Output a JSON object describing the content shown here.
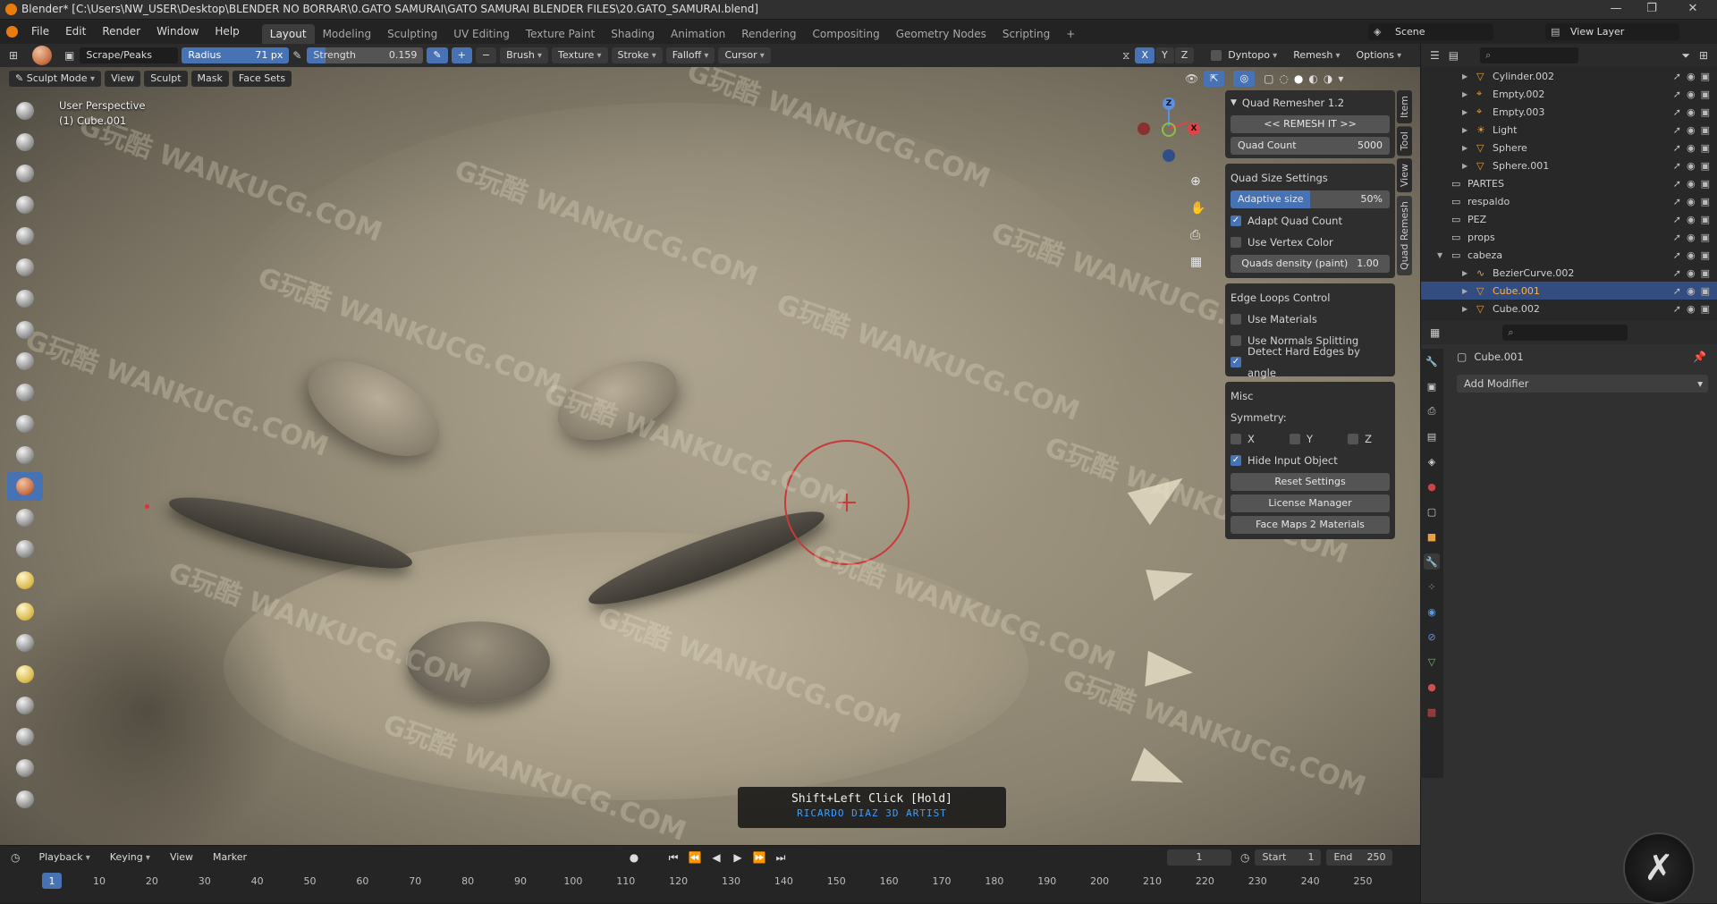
{
  "titlebar": {
    "title": "Blender* [C:\\Users\\NW_USER\\Desktop\\BLENDER NO BORRAR\\0.GATO SAMURAI\\GATO SAMURAI BLENDER FILES\\20.GATO_SAMURAI.blend]"
  },
  "menu": {
    "items": [
      "File",
      "Edit",
      "Render",
      "Window",
      "Help"
    ],
    "workspaces": [
      "Layout",
      "Modeling",
      "Sculpting",
      "UV Editing",
      "Texture Paint",
      "Shading",
      "Animation",
      "Rendering",
      "Compositing",
      "Geometry Nodes",
      "Scripting"
    ],
    "active_workspace": "Layout",
    "add_tab": "+",
    "scene": "Scene",
    "view_layer": "View Layer"
  },
  "tool_header": {
    "brush_name": "Scrape/Peaks",
    "radius_label": "Radius",
    "radius_value": "71 px",
    "strength_label": "Strength",
    "strength_value": "0.159",
    "plus": "+",
    "minus": "−",
    "brush": "Brush",
    "texture": "Texture",
    "stroke": "Stroke",
    "falloff": "Falloff",
    "cursor": "Cursor",
    "axis_x": "X",
    "axis_y": "Y",
    "axis_z": "Z",
    "dyntopo": "Dyntopo",
    "remesh": "Remesh",
    "options": "Options"
  },
  "viewport_header": {
    "mode": "Sculpt Mode",
    "view": "View",
    "sculpt": "Sculpt",
    "mask": "Mask",
    "face_sets": "Face Sets"
  },
  "viewport": {
    "perspective": "User Perspective",
    "object": "(1) Cube.001",
    "hint_key": "Shift+Left Click [Hold]",
    "hint_credit": "RICARDO DIAZ 3D ARTIST",
    "watermark": "G玩酷 WANKUCG.COM",
    "gizmo_x": "X",
    "gizmo_y": "Y",
    "gizmo_z": "Z"
  },
  "quad_remesher": {
    "title": "Quad Remesher 1.2",
    "remesh_btn": "<< REMESH IT >>",
    "quad_count_label": "Quad Count",
    "quad_count_value": "5000",
    "quad_size_settings": "Quad Size Settings",
    "adaptive_size_label": "Adaptive size",
    "adaptive_size_value": "50%",
    "adaptive_size_fraction": 0.5,
    "adapt_quad_count": "Adapt Quad Count",
    "use_vertex_color": "Use Vertex Color",
    "quads_density_label": "Quads density (paint)",
    "quads_density_value": "1.00",
    "edge_loops_control": "Edge Loops Control",
    "use_materials": "Use Materials",
    "use_normals_splitting": "Use Normals Splitting",
    "detect_hard_edges": "Detect Hard Edges by angle",
    "misc": "Misc",
    "symmetry": "Symmetry:",
    "sym_x": "X",
    "sym_y": "Y",
    "sym_z": "Z",
    "hide_input_object": "Hide Input Object",
    "reset_settings": "Reset Settings",
    "license_manager": "License Manager",
    "face_maps_2_materials": "Face Maps 2 Materials",
    "side_tabs": [
      "Item",
      "Tool",
      "View",
      "Quad Remesh"
    ]
  },
  "outliner": {
    "rows": [
      {
        "label": "Cylinder.002",
        "depth": 2
      },
      {
        "label": "Empty.002",
        "depth": 2
      },
      {
        "label": "Empty.003",
        "depth": 2
      },
      {
        "label": "Light",
        "depth": 2
      },
      {
        "label": "Sphere",
        "depth": 2
      },
      {
        "label": "Sphere.001",
        "depth": 2
      },
      {
        "label": "PARTES",
        "depth": 1
      },
      {
        "label": "respaldo",
        "depth": 1
      },
      {
        "label": "PEZ",
        "depth": 1
      },
      {
        "label": "props",
        "depth": 1
      },
      {
        "label": "cabeza",
        "depth": 1
      },
      {
        "label": "BezierCurve.002",
        "depth": 2
      },
      {
        "label": "Cube.001",
        "depth": 2
      },
      {
        "label": "Cube.002",
        "depth": 2
      }
    ],
    "selected": "Cube.001"
  },
  "properties": {
    "object_name": "Cube.001",
    "add_modifier": "Add Modifier"
  },
  "timeline": {
    "playback": "Playback",
    "keying": "Keying",
    "view": "View",
    "marker": "Marker",
    "current_frame": "1",
    "start_label": "Start",
    "start_value": "1",
    "end_label": "End",
    "end_value": "250",
    "ticks": [
      "1",
      "10",
      "20",
      "30",
      "40",
      "50",
      "60",
      "70",
      "80",
      "90",
      "100",
      "110",
      "120",
      "130",
      "140",
      "150",
      "160",
      "170",
      "180",
      "190",
      "200",
      "210",
      "220",
      "230",
      "240",
      "250"
    ]
  }
}
